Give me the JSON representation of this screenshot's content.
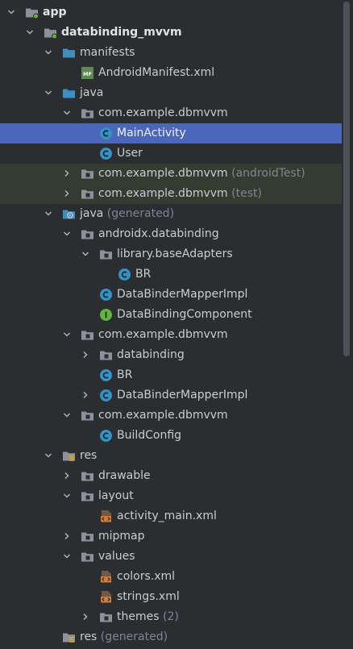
{
  "tree": {
    "rows": [
      {
        "label": "app",
        "suffix": "",
        "icon": "module-folder-icon",
        "chev": "down",
        "depth": 0,
        "bold": true
      },
      {
        "label": "databinding_mvvm",
        "suffix": "",
        "icon": "module-folder-icon",
        "chev": "down",
        "depth": 1,
        "bold": true
      },
      {
        "label": "manifests",
        "suffix": "",
        "icon": "source-folder-icon",
        "chev": "down",
        "depth": 2
      },
      {
        "label": "AndroidManifest.xml",
        "suffix": "",
        "icon": "manifest-file-icon",
        "chev": "",
        "depth": 3
      },
      {
        "label": "java",
        "suffix": "",
        "icon": "source-folder-icon",
        "chev": "down",
        "depth": 2
      },
      {
        "label": "com.example.dbmvvm",
        "suffix": "",
        "icon": "package-folder-icon",
        "chev": "down",
        "depth": 3
      },
      {
        "label": "MainActivity",
        "suffix": "",
        "icon": "class-icon",
        "chev": "",
        "depth": 4,
        "selected": true
      },
      {
        "label": "User",
        "suffix": "",
        "icon": "class-icon",
        "chev": "",
        "depth": 4
      },
      {
        "label": "com.example.dbmvvm",
        "suffix": " (androidTest)",
        "icon": "package-folder-icon",
        "chev": "right",
        "depth": 3,
        "tinted": true
      },
      {
        "label": "com.example.dbmvvm",
        "suffix": " (test)",
        "icon": "package-folder-icon",
        "chev": "right",
        "depth": 3,
        "tinted": true
      },
      {
        "label": "java",
        "suffix": " (generated)",
        "icon": "generated-source-folder-icon",
        "chev": "down",
        "depth": 2
      },
      {
        "label": "androidx.databinding",
        "suffix": "",
        "icon": "package-folder-icon",
        "chev": "down",
        "depth": 3
      },
      {
        "label": "library.baseAdapters",
        "suffix": "",
        "icon": "package-folder-icon",
        "chev": "down",
        "depth": 4
      },
      {
        "label": "BR",
        "suffix": "",
        "icon": "class-icon",
        "chev": "",
        "depth": 5
      },
      {
        "label": "DataBinderMapperImpl",
        "suffix": "",
        "icon": "class-icon",
        "chev": "",
        "depth": 4
      },
      {
        "label": "DataBindingComponent",
        "suffix": "",
        "icon": "interface-icon",
        "chev": "",
        "depth": 4
      },
      {
        "label": "com.example.dbmvvm",
        "suffix": "",
        "icon": "package-folder-icon",
        "chev": "down",
        "depth": 3
      },
      {
        "label": "databinding",
        "suffix": "",
        "icon": "package-folder-icon",
        "chev": "right",
        "depth": 4
      },
      {
        "label": "BR",
        "suffix": "",
        "icon": "class-icon",
        "chev": "",
        "depth": 4
      },
      {
        "label": "DataBinderMapperImpl",
        "suffix": "",
        "icon": "class-icon",
        "chev": "right",
        "depth": 4
      },
      {
        "label": "com.example.dbmvvm",
        "suffix": "",
        "icon": "package-folder-icon",
        "chev": "down",
        "depth": 3
      },
      {
        "label": "BuildConfig",
        "suffix": "",
        "icon": "class-icon",
        "chev": "",
        "depth": 4
      },
      {
        "label": "res",
        "suffix": "",
        "icon": "resource-folder-icon",
        "chev": "down",
        "depth": 2
      },
      {
        "label": "drawable",
        "suffix": "",
        "icon": "package-folder-icon",
        "chev": "right",
        "depth": 3
      },
      {
        "label": "layout",
        "suffix": "",
        "icon": "package-folder-icon",
        "chev": "down",
        "depth": 3
      },
      {
        "label": "activity_main.xml",
        "suffix": "",
        "icon": "xml-file-icon",
        "chev": "",
        "depth": 4
      },
      {
        "label": "mipmap",
        "suffix": "",
        "icon": "package-folder-icon",
        "chev": "right",
        "depth": 3
      },
      {
        "label": "values",
        "suffix": "",
        "icon": "package-folder-icon",
        "chev": "down",
        "depth": 3
      },
      {
        "label": "colors.xml",
        "suffix": "",
        "icon": "xml-file-icon",
        "chev": "",
        "depth": 4
      },
      {
        "label": "strings.xml",
        "suffix": "",
        "icon": "xml-file-icon",
        "chev": "",
        "depth": 4
      },
      {
        "label": "themes",
        "suffix": " (2)",
        "icon": "package-folder-icon",
        "chev": "right",
        "depth": 4
      },
      {
        "label": "res",
        "suffix": " (generated)",
        "icon": "resource-folder-icon",
        "chev": "",
        "depth": 2
      }
    ]
  },
  "colors": {
    "selection": "#4b67b8",
    "test_tint": "#343b31",
    "folder": "#8d9199",
    "source_folder": "#3d8fbf",
    "class_circle": "#3592c4",
    "interface_circle": "#62b543",
    "module_dot": "#5fb832",
    "xml_orange": "#d47b3a"
  },
  "scrollbar": {
    "position_fraction": 0.0,
    "visible_fraction": 0.55
  }
}
